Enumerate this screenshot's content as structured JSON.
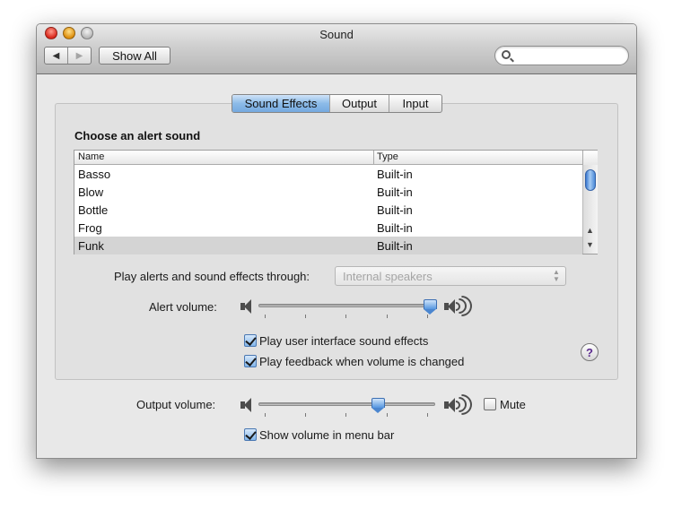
{
  "window": {
    "title": "Sound"
  },
  "toolbar": {
    "show_all_label": "Show All",
    "back_glyph": "◀",
    "forward_glyph": "▶",
    "search_placeholder": "",
    "search_value": ""
  },
  "tabs": [
    {
      "label": "Sound Effects",
      "active": true
    },
    {
      "label": "Output",
      "active": false
    },
    {
      "label": "Input",
      "active": false
    }
  ],
  "sound_effects": {
    "section_title": "Choose an alert sound",
    "columns": [
      "Name",
      "Type"
    ],
    "rows": [
      {
        "name": "Basso",
        "type": "Built-in",
        "selected": false
      },
      {
        "name": "Blow",
        "type": "Built-in",
        "selected": false
      },
      {
        "name": "Bottle",
        "type": "Built-in",
        "selected": false
      },
      {
        "name": "Frog",
        "type": "Built-in",
        "selected": false
      },
      {
        "name": "Funk",
        "type": "Built-in",
        "selected": true
      }
    ],
    "play_through_label": "Play alerts and sound effects through:",
    "play_through_value": "Internal speakers",
    "alert_volume_label": "Alert volume:",
    "alert_volume_level": 0.97,
    "ui_effects_label": "Play user interface sound effects",
    "ui_effects_checked": true,
    "feedback_label": "Play feedback when volume is changed",
    "feedback_checked": true,
    "help_glyph": "?"
  },
  "output": {
    "output_volume_label": "Output volume:",
    "output_volume_level": 0.68,
    "mute_label": "Mute",
    "mute_checked": false,
    "show_in_menubar_label": "Show volume in menu bar",
    "show_in_menubar_checked": true
  },
  "colors": {
    "accent": "#75a9e0",
    "selection": "#d4d4d4",
    "help_glyph": "#5b2a8e"
  }
}
